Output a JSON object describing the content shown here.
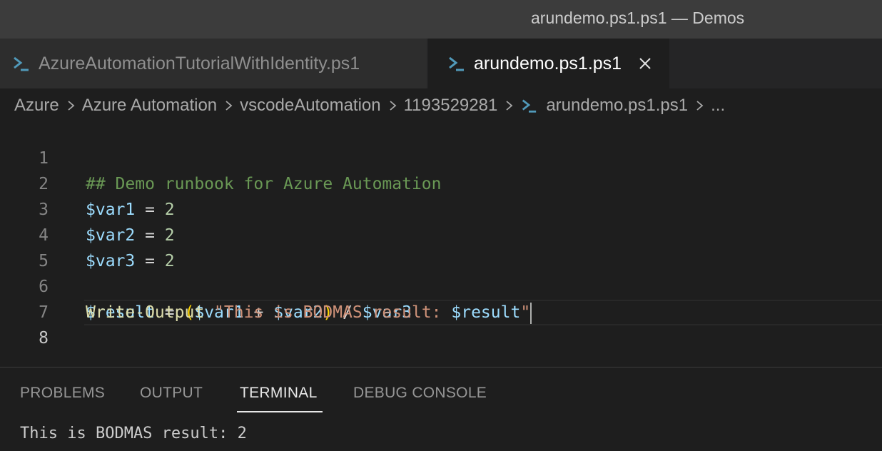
{
  "window": {
    "title": "arundemo.ps1.ps1 — Demos"
  },
  "tabs": [
    {
      "label": "AzureAutomationTutorialWithIdentity.ps1",
      "icon": "powershell-icon",
      "active": false
    },
    {
      "label": "arundemo.ps1.ps1",
      "icon": "powershell-icon",
      "active": true
    }
  ],
  "breadcrumb": {
    "items": [
      "Azure",
      "Azure Automation",
      "vscodeAutomation",
      "1193529281",
      "arundemo.ps1.ps1",
      "..."
    ]
  },
  "editor": {
    "line_numbers": [
      "1",
      "2",
      "3",
      "4",
      "5",
      "6",
      "7",
      "8"
    ],
    "current_line": 8,
    "lines": {
      "l1_comment": "## Demo runbook for Azure Automation",
      "l2_var": "$var1",
      "l2_op": " = ",
      "l2_num": "2",
      "l3_var": "$var2",
      "l3_op": " = ",
      "l3_num": "2",
      "l4_var": "$var3",
      "l4_op": " = ",
      "l4_num": "2",
      "l6_result": "$result",
      "l6_eq": " = ",
      "l6_open": "(",
      "l6_var1": "$var1",
      "l6_plus": " + ",
      "l6_var2": "$var2",
      "l6_close": ")",
      "l6_div": " / ",
      "l6_var3": "$var3",
      "l8_func": "Write-Output",
      "l8_space": " ",
      "l8_str": "\"This is BODMAS result: ",
      "l8_interp": "$result",
      "l8_quote": "\""
    }
  },
  "panel": {
    "tabs": [
      "PROBLEMS",
      "OUTPUT",
      "TERMINAL",
      "DEBUG CONSOLE"
    ],
    "active_tab": "TERMINAL",
    "terminal_output": "This is BODMAS result: 2"
  },
  "colors": {
    "accent_icon": "#519aba",
    "comment": "#6a9955",
    "variable": "#9cdcfe",
    "number": "#b5cea8",
    "string": "#ce9178",
    "function": "#dcdcaa",
    "bracket": "#ffd700"
  }
}
